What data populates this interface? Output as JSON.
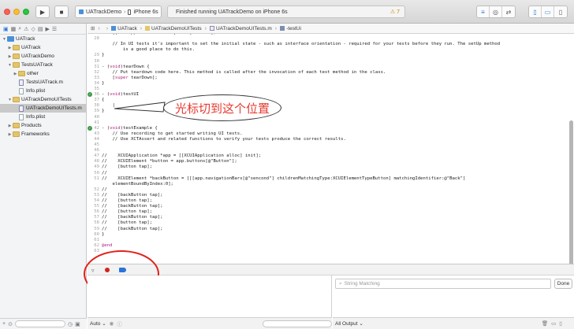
{
  "toolbar": {
    "run_icon": "play-icon",
    "stop_icon": "stop-icon",
    "scheme": "UATrackDemo",
    "device": "iPhone 6s",
    "status_text": "Finished running UATrackDemo on iPhone 6s",
    "warning_count": "7"
  },
  "navigator": {
    "items": [
      {
        "label": "UATrack",
        "kind": "project",
        "indent": 0,
        "open": true
      },
      {
        "label": "UATrack",
        "kind": "folder",
        "indent": 1,
        "open": false
      },
      {
        "label": "UATrackDemo",
        "kind": "folder",
        "indent": 1,
        "open": false
      },
      {
        "label": "TestsUATrack",
        "kind": "folder",
        "indent": 1,
        "open": true
      },
      {
        "label": "other",
        "kind": "folder",
        "indent": 2,
        "open": false
      },
      {
        "label": "TestsUATrack.m",
        "kind": "file-m",
        "indent": 2,
        "open": null
      },
      {
        "label": "Info.plist",
        "kind": "file",
        "indent": 2,
        "open": null
      },
      {
        "label": "UATrackDemoUITests",
        "kind": "folder",
        "indent": 1,
        "open": true
      },
      {
        "label": "UATrackDemoUITests.m",
        "kind": "file-m",
        "indent": 2,
        "open": null,
        "selected": true
      },
      {
        "label": "Info.plist",
        "kind": "file",
        "indent": 2,
        "open": null
      },
      {
        "label": "Products",
        "kind": "folder",
        "indent": 1,
        "open": false
      },
      {
        "label": "Frameworks",
        "kind": "folder",
        "indent": 1,
        "open": false
      }
    ]
  },
  "jumpbar": {
    "crumbs": [
      "UATrack",
      "UATrackDemoUITests",
      "UATrackDemoUITests.m",
      "-testUi"
    ]
  },
  "editor": {
    "lines": [
      {
        "n": "27",
        "t": "    [[XCUIApplication alloc] init] launch];",
        "c": "plain"
      },
      {
        "n": "28",
        "t": "",
        "c": "plain"
      },
      {
        "n": "",
        "t": "    // In UI tests it's important to set the initial state - such as interface orientation - required for your tests before they run. The setUp method",
        "c": "comment"
      },
      {
        "n": "",
        "t": "        is a good place to do this.",
        "c": "comment"
      },
      {
        "n": "29",
        "t": "}",
        "c": "plain"
      },
      {
        "n": "30",
        "t": "",
        "c": "plain"
      },
      {
        "n": "31",
        "t": "- (void)tearDown {",
        "c": "decl"
      },
      {
        "n": "32",
        "t": "    // Put teardown code here. This method is called after the invocation of each test method in the class.",
        "c": "comment"
      },
      {
        "n": "33",
        "t": "    [super tearDown];",
        "c": "kw"
      },
      {
        "n": "34",
        "t": "}",
        "c": "plain"
      },
      {
        "n": "35",
        "t": "",
        "c": "plain"
      },
      {
        "n": "36",
        "t": "- (void)testUI",
        "c": "decl",
        "test": true
      },
      {
        "n": "37",
        "t": "{",
        "c": "plain"
      },
      {
        "n": "38",
        "t": "    |",
        "c": "plain"
      },
      {
        "n": "39",
        "t": "}",
        "c": "plain"
      },
      {
        "n": "40",
        "t": "",
        "c": "plain"
      },
      {
        "n": "41",
        "t": "",
        "c": "plain"
      },
      {
        "n": "42",
        "t": "- (void)testExample {",
        "c": "decl",
        "test": true
      },
      {
        "n": "43",
        "t": "    // Use recording to get started writing UI tests.",
        "c": "comment"
      },
      {
        "n": "44",
        "t": "    // Use XCTAssert and related functions to verify your tests produce the correct results.",
        "c": "comment"
      },
      {
        "n": "45",
        "t": "",
        "c": "plain"
      },
      {
        "n": "46",
        "t": "",
        "c": "plain"
      },
      {
        "n": "47",
        "t": "//    XCUIApplication *app = [[XCUIApplication alloc] init];",
        "c": "comment"
      },
      {
        "n": "48",
        "t": "//    XCUIElement *button = app.buttons[@\"Button\"];",
        "c": "comment"
      },
      {
        "n": "49",
        "t": "//    [button tap];",
        "c": "comment"
      },
      {
        "n": "50",
        "t": "//",
        "c": "comment"
      },
      {
        "n": "51",
        "t": "//    XCUIElement *backButton = [[[app.navigationBars[@\"sencond\"] childrenMatchingType:XCUIElementTypeButton] matchingIdentifier:@\"Back\"]",
        "c": "comment"
      },
      {
        "n": "",
        "t": "    elementBoundByIndex:0];",
        "c": "comment"
      },
      {
        "n": "52",
        "t": "//",
        "c": "comment"
      },
      {
        "n": "53",
        "t": "//    [backButton tap];",
        "c": "comment"
      },
      {
        "n": "54",
        "t": "//    [button tap];",
        "c": "comment"
      },
      {
        "n": "55",
        "t": "//    [backButton tap];",
        "c": "comment"
      },
      {
        "n": "56",
        "t": "//    [button tap];",
        "c": "comment"
      },
      {
        "n": "57",
        "t": "//    [backButton tap];",
        "c": "comment"
      },
      {
        "n": "58",
        "t": "//    [button tap];",
        "c": "comment"
      },
      {
        "n": "59",
        "t": "//    [backButton tap];",
        "c": "comment"
      },
      {
        "n": "60",
        "t": "}",
        "c": "plain"
      },
      {
        "n": "61",
        "t": "",
        "c": "plain"
      },
      {
        "n": "62",
        "t": "@end",
        "c": "kw"
      },
      {
        "n": "63",
        "t": "",
        "c": "plain"
      }
    ],
    "callout_text": "光标切到这个位置"
  },
  "debug": {
    "search_placeholder": "String Matching",
    "done_label": "Done",
    "auto_label": "Auto",
    "all_output_label": "All Output"
  },
  "colors": {
    "accent": "#2a73d8",
    "annotation_red": "#e0221a"
  }
}
